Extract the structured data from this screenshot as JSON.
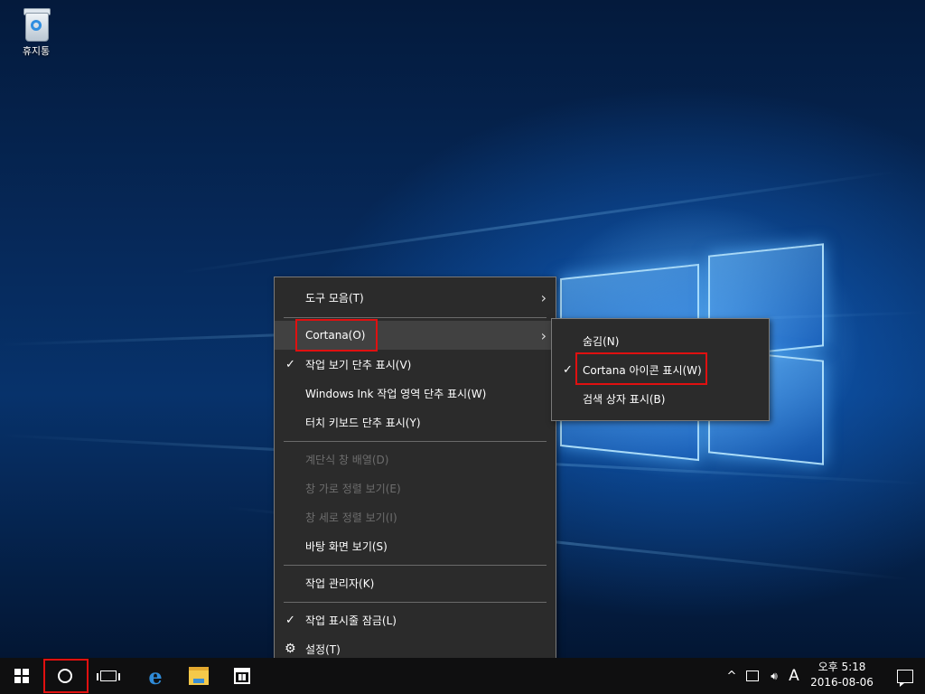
{
  "desktop": {
    "recycle_bin_label": "휴지통"
  },
  "context_menu": {
    "items": [
      {
        "label": "도구 모음(T)",
        "has_submenu": true
      },
      {
        "label": "Cortana(O)",
        "has_submenu": true,
        "highlighted": true
      },
      {
        "label": "작업 보기 단추 표시(V)",
        "checked": true
      },
      {
        "label": "Windows Ink 작업 영역 단추 표시(W)"
      },
      {
        "label": "터치 키보드 단추 표시(Y)"
      },
      {
        "label": "계단식 창 배열(D)",
        "disabled": true
      },
      {
        "label": "창 가로 정렬 보기(E)",
        "disabled": true
      },
      {
        "label": "창 세로 정렬 보기(I)",
        "disabled": true
      },
      {
        "label": "바탕 화면 보기(S)"
      },
      {
        "label": "작업 관리자(K)"
      },
      {
        "label": "작업 표시줄 잠금(L)",
        "checked": true
      },
      {
        "label": "설정(T)",
        "icon": "gear-icon"
      }
    ]
  },
  "cortana_submenu": {
    "items": [
      {
        "label": "숨김(N)"
      },
      {
        "label": "Cortana 아이콘 표시(W)",
        "checked": true
      },
      {
        "label": "검색 상자 표시(B)"
      }
    ]
  },
  "taskbar": {
    "tray": {
      "ime_label": "A",
      "time": "오후 5:18",
      "date": "2016-08-06"
    }
  },
  "icons": {
    "check": "✓",
    "arrow": "›",
    "gear": "⚙",
    "chevron_up": "^",
    "volume": "🔊"
  }
}
